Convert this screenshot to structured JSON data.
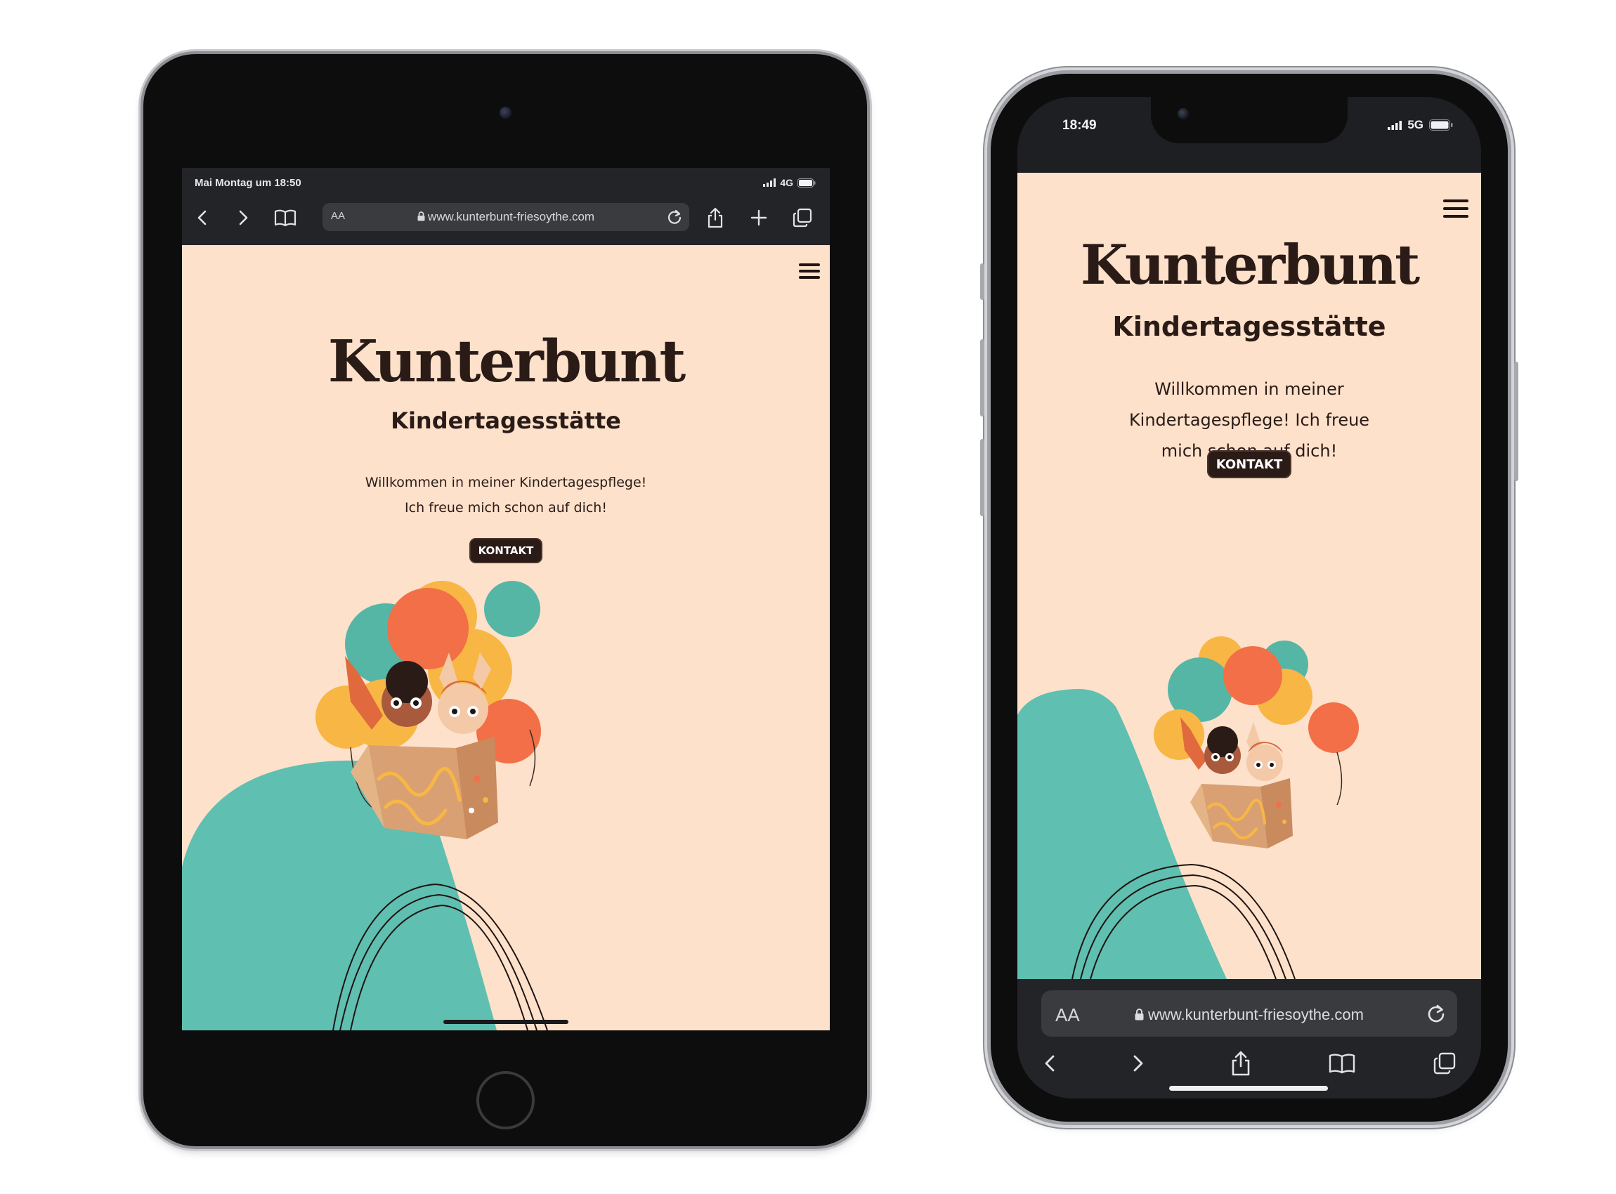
{
  "site": {
    "logo": "Kunterbunt",
    "subtitle": "Kindertagesstätte",
    "welcome_tablet_line1": "Willkommen in meiner Kindertagespflege!",
    "welcome_tablet_line2": "Ich freue mich schon auf dich!",
    "welcome_phone_line1": "Willkommen in meiner",
    "welcome_phone_line2": "Kindertagespflege! Ich freue",
    "welcome_phone_line3": "mich schon auf dich!",
    "cta_label": "KONTAKT",
    "url": "www.kunterbunt-friesoythe.com",
    "reader_label": "AA",
    "colors": {
      "page_bg": "#fde1cb",
      "teal": "#5fbfb0",
      "text_dark": "#2a1b17",
      "balloon_orange": "#f36f47",
      "balloon_yellow": "#f8b744",
      "balloon_teal": "#56b6a6"
    }
  },
  "tablet": {
    "status_left": "Mai Montag um 18:50",
    "network": "4G",
    "icons": [
      "back-icon",
      "forward-icon",
      "bookmarks-icon",
      "lock-icon",
      "reload-icon",
      "share-icon",
      "plus-icon",
      "tabs-icon",
      "menu-icon"
    ]
  },
  "phone": {
    "time": "18:49",
    "network": "5G",
    "icons": [
      "back-icon",
      "forward-icon",
      "share-icon",
      "bookmarks-icon",
      "tabs-icon",
      "lock-icon",
      "reload-icon",
      "menu-icon"
    ]
  }
}
